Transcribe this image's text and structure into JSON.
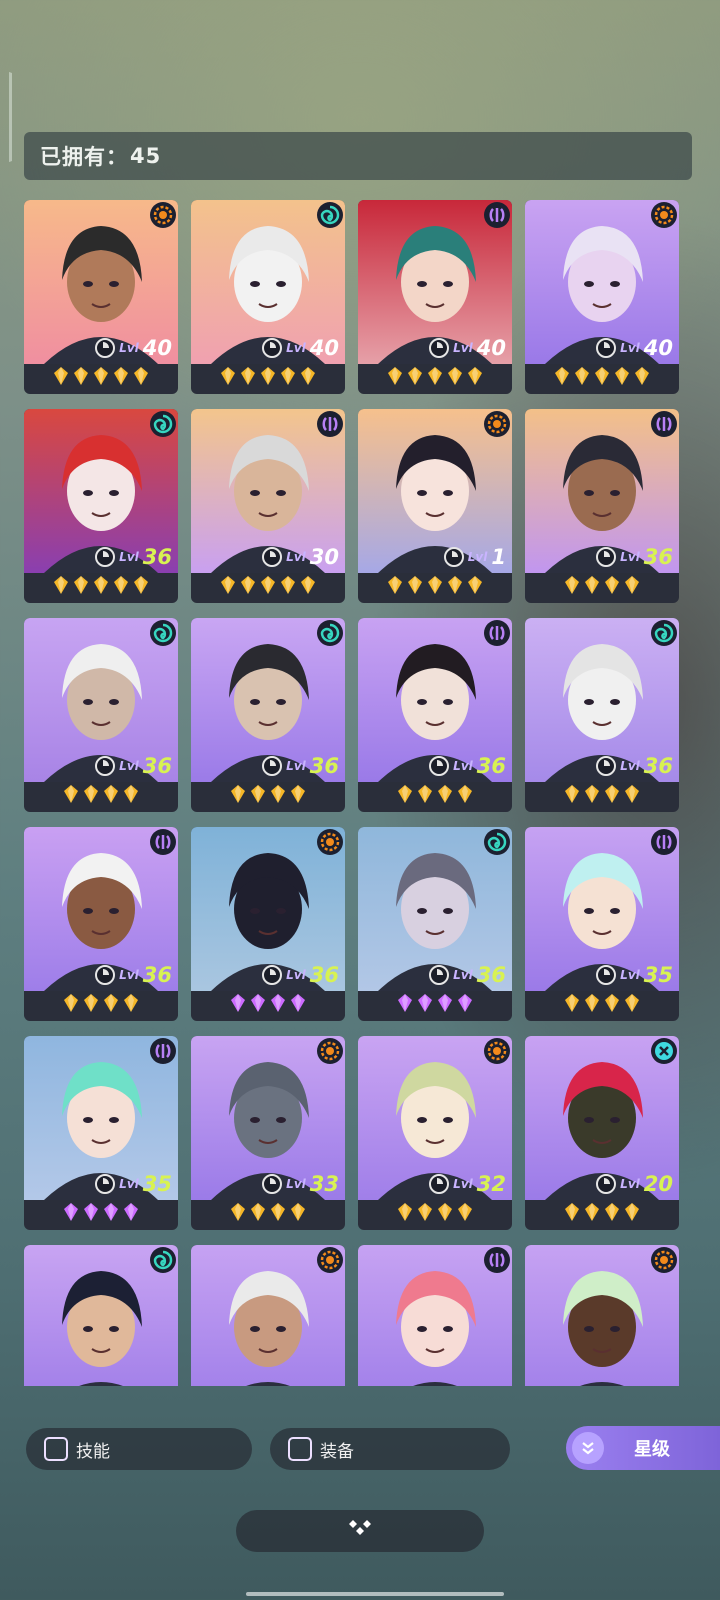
{
  "header": {
    "owned_label": "已拥有：",
    "owned_count": "45"
  },
  "level_prefix": "Lvl",
  "colors": {
    "orange_badge": "#f28a1c",
    "teal_badge": "#37d6c0",
    "purple_badge": "#b780f5",
    "cross_badge": "#3fd9e0",
    "gold_gem": "#f5b728",
    "purple_gem": "#cc6bff",
    "level_highlight": "#d8f252"
  },
  "cards": [
    {
      "level": "40",
      "element": "sun",
      "gem_color": "gold",
      "gems": 5,
      "bg": [
        "#f7b98a",
        "#f08fa0"
      ],
      "hair": "#2b2b2b",
      "skin": "#b07a5a"
    },
    {
      "level": "40",
      "element": "swirl",
      "gem_color": "gold",
      "gems": 5,
      "bg": [
        "#f3c28c",
        "#f0a1b0"
      ],
      "hair": "#eaeaea",
      "skin": "#f2f2f2"
    },
    {
      "level": "40",
      "element": "moon",
      "gem_color": "gold",
      "gems": 5,
      "bg": [
        "#c8283a",
        "#e6a0a8"
      ],
      "hair": "#2a7f7a",
      "skin": "#f3d6c8"
    },
    {
      "level": "40",
      "element": "sun",
      "gem_color": "gold",
      "gems": 5,
      "bg": [
        "#c9a3f2",
        "#9a79e8"
      ],
      "hair": "#e9e2f4",
      "skin": "#e8d3f0"
    },
    {
      "level": "36",
      "element": "swirl",
      "gem_color": "gold",
      "gems": 5,
      "bg": [
        "#d9483f",
        "#8a3fb0"
      ],
      "hair": "#d83030",
      "skin": "#f4e6e6"
    },
    {
      "level": "30",
      "element": "moon",
      "gem_color": "gold",
      "gems": 5,
      "bg": [
        "#f3c58c",
        "#c9a0f0"
      ],
      "hair": "#d9d9d9",
      "skin": "#d9b59a"
    },
    {
      "level": "1",
      "element": "sun",
      "gem_color": "gold",
      "gems": 5,
      "bg": [
        "#f6c08c",
        "#a6a8e6"
      ],
      "hair": "#231f2c",
      "skin": "#f7e3dc"
    },
    {
      "level": "36",
      "element": "moon",
      "gem_color": "gold",
      "gems": 4,
      "bg": [
        "#f3c088",
        "#c196ef"
      ],
      "hair": "#2a2a36",
      "skin": "#9a6b50"
    },
    {
      "level": "36",
      "element": "swirl",
      "gem_color": "gold",
      "gems": 4,
      "bg": [
        "#c7a4f2",
        "#a884e6"
      ],
      "hair": "#efefef",
      "skin": "#d0b8a8"
    },
    {
      "level": "36",
      "element": "swirl",
      "gem_color": "gold",
      "gems": 4,
      "bg": [
        "#c9a6f3",
        "#9b7be8"
      ],
      "hair": "#2a2a30",
      "skin": "#d9c2b0"
    },
    {
      "level": "36",
      "element": "moon",
      "gem_color": "gold",
      "gems": 4,
      "bg": [
        "#c8a2f2",
        "#9a7ae8"
      ],
      "hair": "#221c22",
      "skin": "#f1e1d9"
    },
    {
      "level": "36",
      "element": "swirl",
      "gem_color": "gold",
      "gems": 4,
      "bg": [
        "#cbb0f3",
        "#a58ae9"
      ],
      "hair": "#e4e4e4",
      "skin": "#f0f0f0"
    },
    {
      "level": "36",
      "element": "moon",
      "gem_color": "gold",
      "gems": 4,
      "bg": [
        "#c9a0f2",
        "#9e7ee9"
      ],
      "hair": "#f2f2f2",
      "skin": "#8a5a42"
    },
    {
      "level": "36",
      "element": "sun",
      "gem_color": "purple",
      "gems": 4,
      "bg": [
        "#7fb2d8",
        "#a9c6e0"
      ],
      "hair": "#1f1f2e",
      "skin": "#1f1f2e"
    },
    {
      "level": "36",
      "element": "swirl",
      "gem_color": "purple",
      "gems": 4,
      "bg": [
        "#8fb7db",
        "#b2c7e6"
      ],
      "hair": "#6a6a7e",
      "skin": "#d8d0e0"
    },
    {
      "level": "35",
      "element": "moon",
      "gem_color": "gold",
      "gems": 4,
      "bg": [
        "#c6a2f2",
        "#9b7ae8"
      ],
      "hair": "#bff0f0",
      "skin": "#f5e1d3"
    },
    {
      "level": "35",
      "element": "moon",
      "gem_color": "purple",
      "gems": 4,
      "bg": [
        "#8fb6df",
        "#b3c8e8"
      ],
      "hair": "#6fe0c8",
      "skin": "#f5e0d6"
    },
    {
      "level": "33",
      "element": "sun",
      "gem_color": "gold",
      "gems": 4,
      "bg": [
        "#c8a4f2",
        "#9b7be8"
      ],
      "hair": "#5a6270",
      "skin": "#6a7280"
    },
    {
      "level": "32",
      "element": "sun",
      "gem_color": "gold",
      "gems": 4,
      "bg": [
        "#c9a4f2",
        "#a07fe9"
      ],
      "hair": "#cfd8a0",
      "skin": "#f6e8d6"
    },
    {
      "level": "20",
      "element": "cross",
      "gem_color": "gold",
      "gems": 4,
      "bg": [
        "#c8a2f2",
        "#9b7be8"
      ],
      "hair": "#d8254a",
      "skin": "#3a3a2a"
    },
    {
      "level": "",
      "element": "swirl",
      "gem_color": "gold",
      "gems": 0,
      "bg": [
        "#c8a4f2",
        "#9e7ce8"
      ],
      "hair": "#1c2034",
      "skin": "#e0b89a"
    },
    {
      "level": "",
      "element": "sun",
      "gem_color": "gold",
      "gems": 0,
      "bg": [
        "#c6a2f2",
        "#9e7de9"
      ],
      "hair": "#eaeaea",
      "skin": "#c89a80"
    },
    {
      "level": "",
      "element": "moon",
      "gem_color": "gold",
      "gems": 0,
      "bg": [
        "#c6a2f2",
        "#9e7de9"
      ],
      "hair": "#ef7a8e",
      "skin": "#f7dcd6"
    },
    {
      "level": "",
      "element": "sun",
      "gem_color": "gold",
      "gems": 0,
      "bg": [
        "#c6a2f2",
        "#9e7de9"
      ],
      "hair": "#cfeec8",
      "skin": "#5a3a2a"
    }
  ],
  "filters": {
    "skill_label": "技能",
    "equip_label": "装备"
  },
  "sort": {
    "label": "星级",
    "icon": "double-chevron-down-icon"
  },
  "expand": {
    "icon": "diamond-cluster-icon"
  }
}
